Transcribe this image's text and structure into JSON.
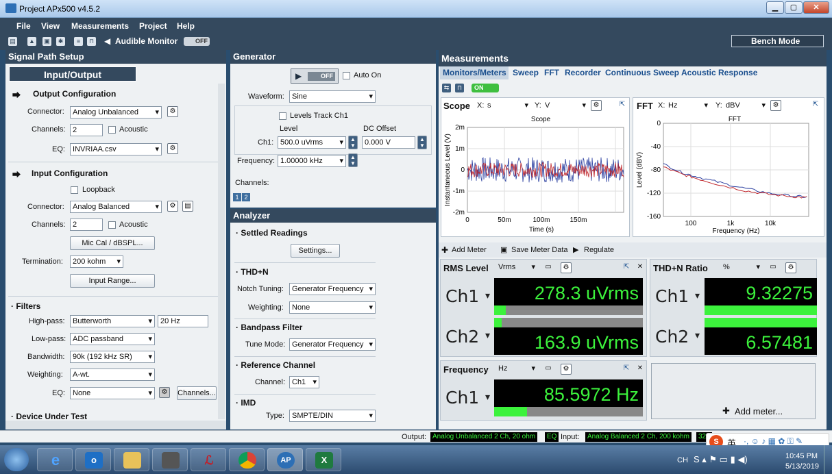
{
  "window": {
    "title": "Project   APx500 v4.5.2",
    "min": "▁",
    "max": "▢",
    "close": "✕"
  },
  "menu": [
    "File",
    "View",
    "Measurements",
    "Project",
    "Help"
  ],
  "toolbar": {
    "audible_monitor": "Audible Monitor",
    "audible_toggle": "OFF",
    "bench_mode": "Bench Mode"
  },
  "signal_path": {
    "title": "Signal Path Setup",
    "selector": "Input/Output",
    "output_config": {
      "heading": "Output Configuration",
      "connector_label": "Connector:",
      "connector": "Analog Unbalanced",
      "channels_label": "Channels:",
      "channels": "2",
      "acoustic": "Acoustic",
      "eq_label": "EQ:",
      "eq": "INVRIAA.csv"
    },
    "input_config": {
      "heading": "Input Configuration",
      "loopback": "Loopback",
      "connector_label": "Connector:",
      "connector": "Analog Balanced",
      "channels_label": "Channels:",
      "channels": "2",
      "acoustic": "Acoustic",
      "mic_cal": "Mic Cal / dBSPL...",
      "termination_label": "Termination:",
      "termination": "200 kohm",
      "input_range": "Input Range..."
    },
    "filters": {
      "heading": "· Filters",
      "highpass_label": "High-pass:",
      "highpass": "Butterworth",
      "highpass_freq": "20 Hz",
      "lowpass_label": "Low-pass:",
      "lowpass": "ADC passband",
      "bandwidth_label": "Bandwidth:",
      "bandwidth": "90k (192 kHz SR)",
      "weighting_label": "Weighting:",
      "weighting": "A-wt.",
      "eq_label": "EQ:",
      "eq": "None",
      "channels_btn": "Channels..."
    },
    "dut": "· Device Under Test"
  },
  "generator": {
    "title": "Generator",
    "power": "OFF",
    "auto_on": "Auto On",
    "waveform_label": "Waveform:",
    "waveform": "Sine",
    "levels_track": "Levels Track Ch1",
    "level_label": "Level",
    "dc_offset_label": "DC Offset",
    "ch1_label": "Ch1:",
    "level": "500.0 uVrms",
    "dc_offset": "0.000 V",
    "frequency_label": "Frequency:",
    "frequency": "1.00000 kHz",
    "channels_label": "Channels:",
    "ch_buttons": [
      "1",
      "2"
    ]
  },
  "analyzer": {
    "title": "Analyzer",
    "settled_heading": "· Settled Readings",
    "settings_btn": "Settings...",
    "thdn_heading": "· THD+N",
    "notch_label": "Notch Tuning:",
    "notch": "Generator Frequency",
    "weighting_label": "Weighting:",
    "weighting": "None",
    "bandpass_heading": "· Bandpass Filter",
    "tune_label": "Tune Mode:",
    "tune": "Generator Frequency",
    "ref_heading": "· Reference Channel",
    "channel_label": "Channel:",
    "channel": "Ch1",
    "imd_heading": "· IMD",
    "type_label": "Type:",
    "type": "SMPTE/DIN"
  },
  "measurements": {
    "title": "Measurements",
    "tabs": [
      "Monitors/Meters",
      "Sweep",
      "FFT",
      "Recorder",
      "Continuous Sweep",
      "Acoustic Response"
    ],
    "on_toggle": "ON",
    "scope": {
      "title": "Scope",
      "x_label": "X:",
      "x_unit": "s",
      "y_label": "Y:",
      "y_unit": "V",
      "chart_title": "Scope",
      "xlabel": "Time (s)",
      "ylabel": "Instantaneous Level (V)",
      "yticks": [
        "2m",
        "1m",
        "0",
        "-1m",
        "-2m"
      ],
      "xticks": [
        "0",
        "50m",
        "100m",
        "150m"
      ]
    },
    "fft": {
      "title": "FFT",
      "x_label": "X:",
      "x_unit": "Hz",
      "y_label": "Y:",
      "y_unit": "dBV",
      "chart_title": "FFT",
      "xlabel": "Frequency (Hz)",
      "ylabel": "Level (dBV)",
      "yticks": [
        "0",
        "-40",
        "-80",
        "-120",
        "-160"
      ],
      "xticks": [
        "100",
        "1k",
        "10k"
      ]
    },
    "meter_toolbar": {
      "add_meter": "Add Meter",
      "save": "Save Meter Data",
      "regulate": "Regulate"
    },
    "rms": {
      "title": "RMS Level",
      "unit": "Vrms",
      "ch1": "Ch1",
      "ch2": "Ch2",
      "ch1_value": "278.3 uVrms",
      "ch2_value": "163.9 uVrms"
    },
    "thdn": {
      "title": "THD+N Ratio",
      "unit": "%",
      "ch1": "Ch1",
      "ch2": "Ch2",
      "ch1_value": "9.32275",
      "ch2_value": "6.57481"
    },
    "freq": {
      "title": "Frequency",
      "unit": "Hz",
      "ch1": "Ch1",
      "ch1_value": "85.5972 Hz"
    },
    "add_meter_panel": "Add meter..."
  },
  "status": {
    "output_label": "Output:",
    "output": "Analog Unbalanced 2 Ch, 20 ohm",
    "eq": "EQ",
    "input_label": "Input:",
    "input": "Analog Balanced 2 Ch, 200 kohm",
    "input_extra": "320"
  },
  "taskbar": {
    "lang": "CH",
    "time": "10:45 PM",
    "date": "5/13/2019",
    "ime": "英"
  },
  "chart_data": [
    {
      "type": "line",
      "title": "Scope",
      "xlabel": "Time (s)",
      "ylabel": "Instantaneous Level (V)",
      "xlim": [
        0,
        0.2
      ],
      "ylim": [
        -0.002,
        0.002
      ],
      "series": [
        {
          "color": "#2b3fa0",
          "values": "noise ~±0.6m"
        },
        {
          "color": "#c0262b",
          "values": "noise ~±0.4m"
        }
      ],
      "grid": true
    },
    {
      "type": "line",
      "title": "FFT",
      "xlabel": "Frequency (Hz)",
      "ylabel": "Level (dBV)",
      "x_scale": "log",
      "xlim": [
        20,
        20000
      ],
      "ylim": [
        -160,
        0
      ],
      "series": [
        {
          "color": "#2b3fa0",
          "x": [
            20,
            50,
            100,
            300,
            1000,
            3000,
            10000,
            20000
          ],
          "values": [
            -70,
            -85,
            -92,
            -102,
            -112,
            -120,
            -125,
            -127
          ]
        },
        {
          "color": "#c0262b",
          "x": [
            20,
            50,
            100,
            300,
            1000,
            3000,
            10000,
            20000
          ],
          "values": [
            -75,
            -88,
            -95,
            -106,
            -116,
            -122,
            -126,
            -128
          ]
        }
      ],
      "grid": true
    }
  ]
}
